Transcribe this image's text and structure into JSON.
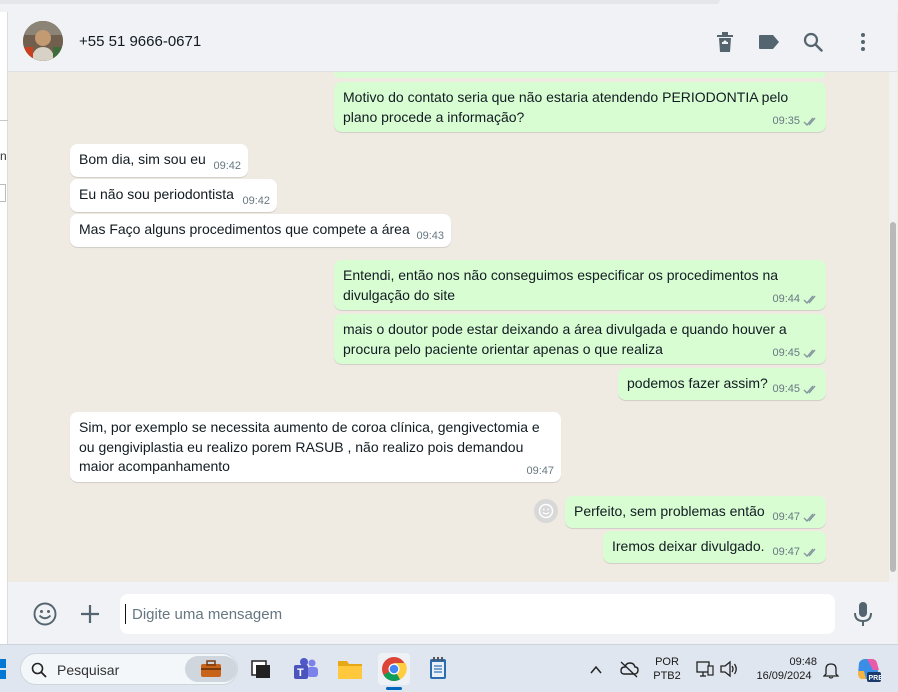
{
  "header": {
    "contact_name": "+55 51 9666-0671"
  },
  "messages": [
    {
      "dir": "out",
      "text": "Motivo do contato seria que não estaria atendendo PERIODONTIA pelo plano procede a informação?",
      "time": "09:35"
    },
    {
      "dir": "in",
      "text": "Bom dia, sim sou eu",
      "time": "09:42"
    },
    {
      "dir": "in",
      "text": "Eu não sou periodontista",
      "time": "09:42"
    },
    {
      "dir": "in",
      "text": "Mas Faço alguns procedimentos que compete a área",
      "time": "09:43"
    },
    {
      "dir": "out",
      "text": "Entendi, então nos não conseguimos especificar os procedimentos na divulgação do site",
      "time": "09:44"
    },
    {
      "dir": "out",
      "text": "mais o doutor pode estar deixando a área divulgada e quando houver a procura pelo paciente orientar apenas o que realiza",
      "time": "09:45"
    },
    {
      "dir": "out",
      "text": "podemos fazer assim?",
      "time": "09:45"
    },
    {
      "dir": "in",
      "text": "Sim, por exemplo se necessita aumento de coroa clínica, gengivectomia e ou gengiviplastia eu realizo porem RASUB , não realizo pois demandou maior acompanhamento",
      "time": "09:47"
    },
    {
      "dir": "out",
      "text": "Perfeito, sem problemas então",
      "time": "09:47"
    },
    {
      "dir": "out",
      "text": "Iremos deixar divulgado.",
      "time": "09:47"
    }
  ],
  "footer": {
    "input_placeholder": "Digite uma mensagem",
    "input_value": ""
  },
  "taskbar": {
    "search_label": "Pesquisar",
    "lang_line1": "POR",
    "lang_line2": "PTB2",
    "time": "09:48",
    "date": "16/09/2024"
  },
  "left_edge_text": "n",
  "colors": {
    "incoming_bubble": "#ffffff",
    "outgoing_bubble": "#d9fdd3",
    "chat_background": "#efeae2",
    "header_background": "#f0f2f5",
    "tick_color": "#8696a0",
    "taskbar_active": "#0067c0"
  },
  "icons": {
    "header": [
      "trash-icon",
      "label-icon",
      "search-icon",
      "menu-icon"
    ],
    "footer": [
      "emoji-icon",
      "plus-icon",
      "mic-icon"
    ],
    "taskbar": [
      "windows-icon",
      "search-icon",
      "briefcase-icon",
      "app-icon",
      "teams-icon",
      "explorer-icon",
      "chrome-icon",
      "notepad-icon",
      "chevron-up-icon",
      "cloud-off-icon",
      "display-icon",
      "volume-icon",
      "bell-icon",
      "copilot-icon"
    ]
  }
}
